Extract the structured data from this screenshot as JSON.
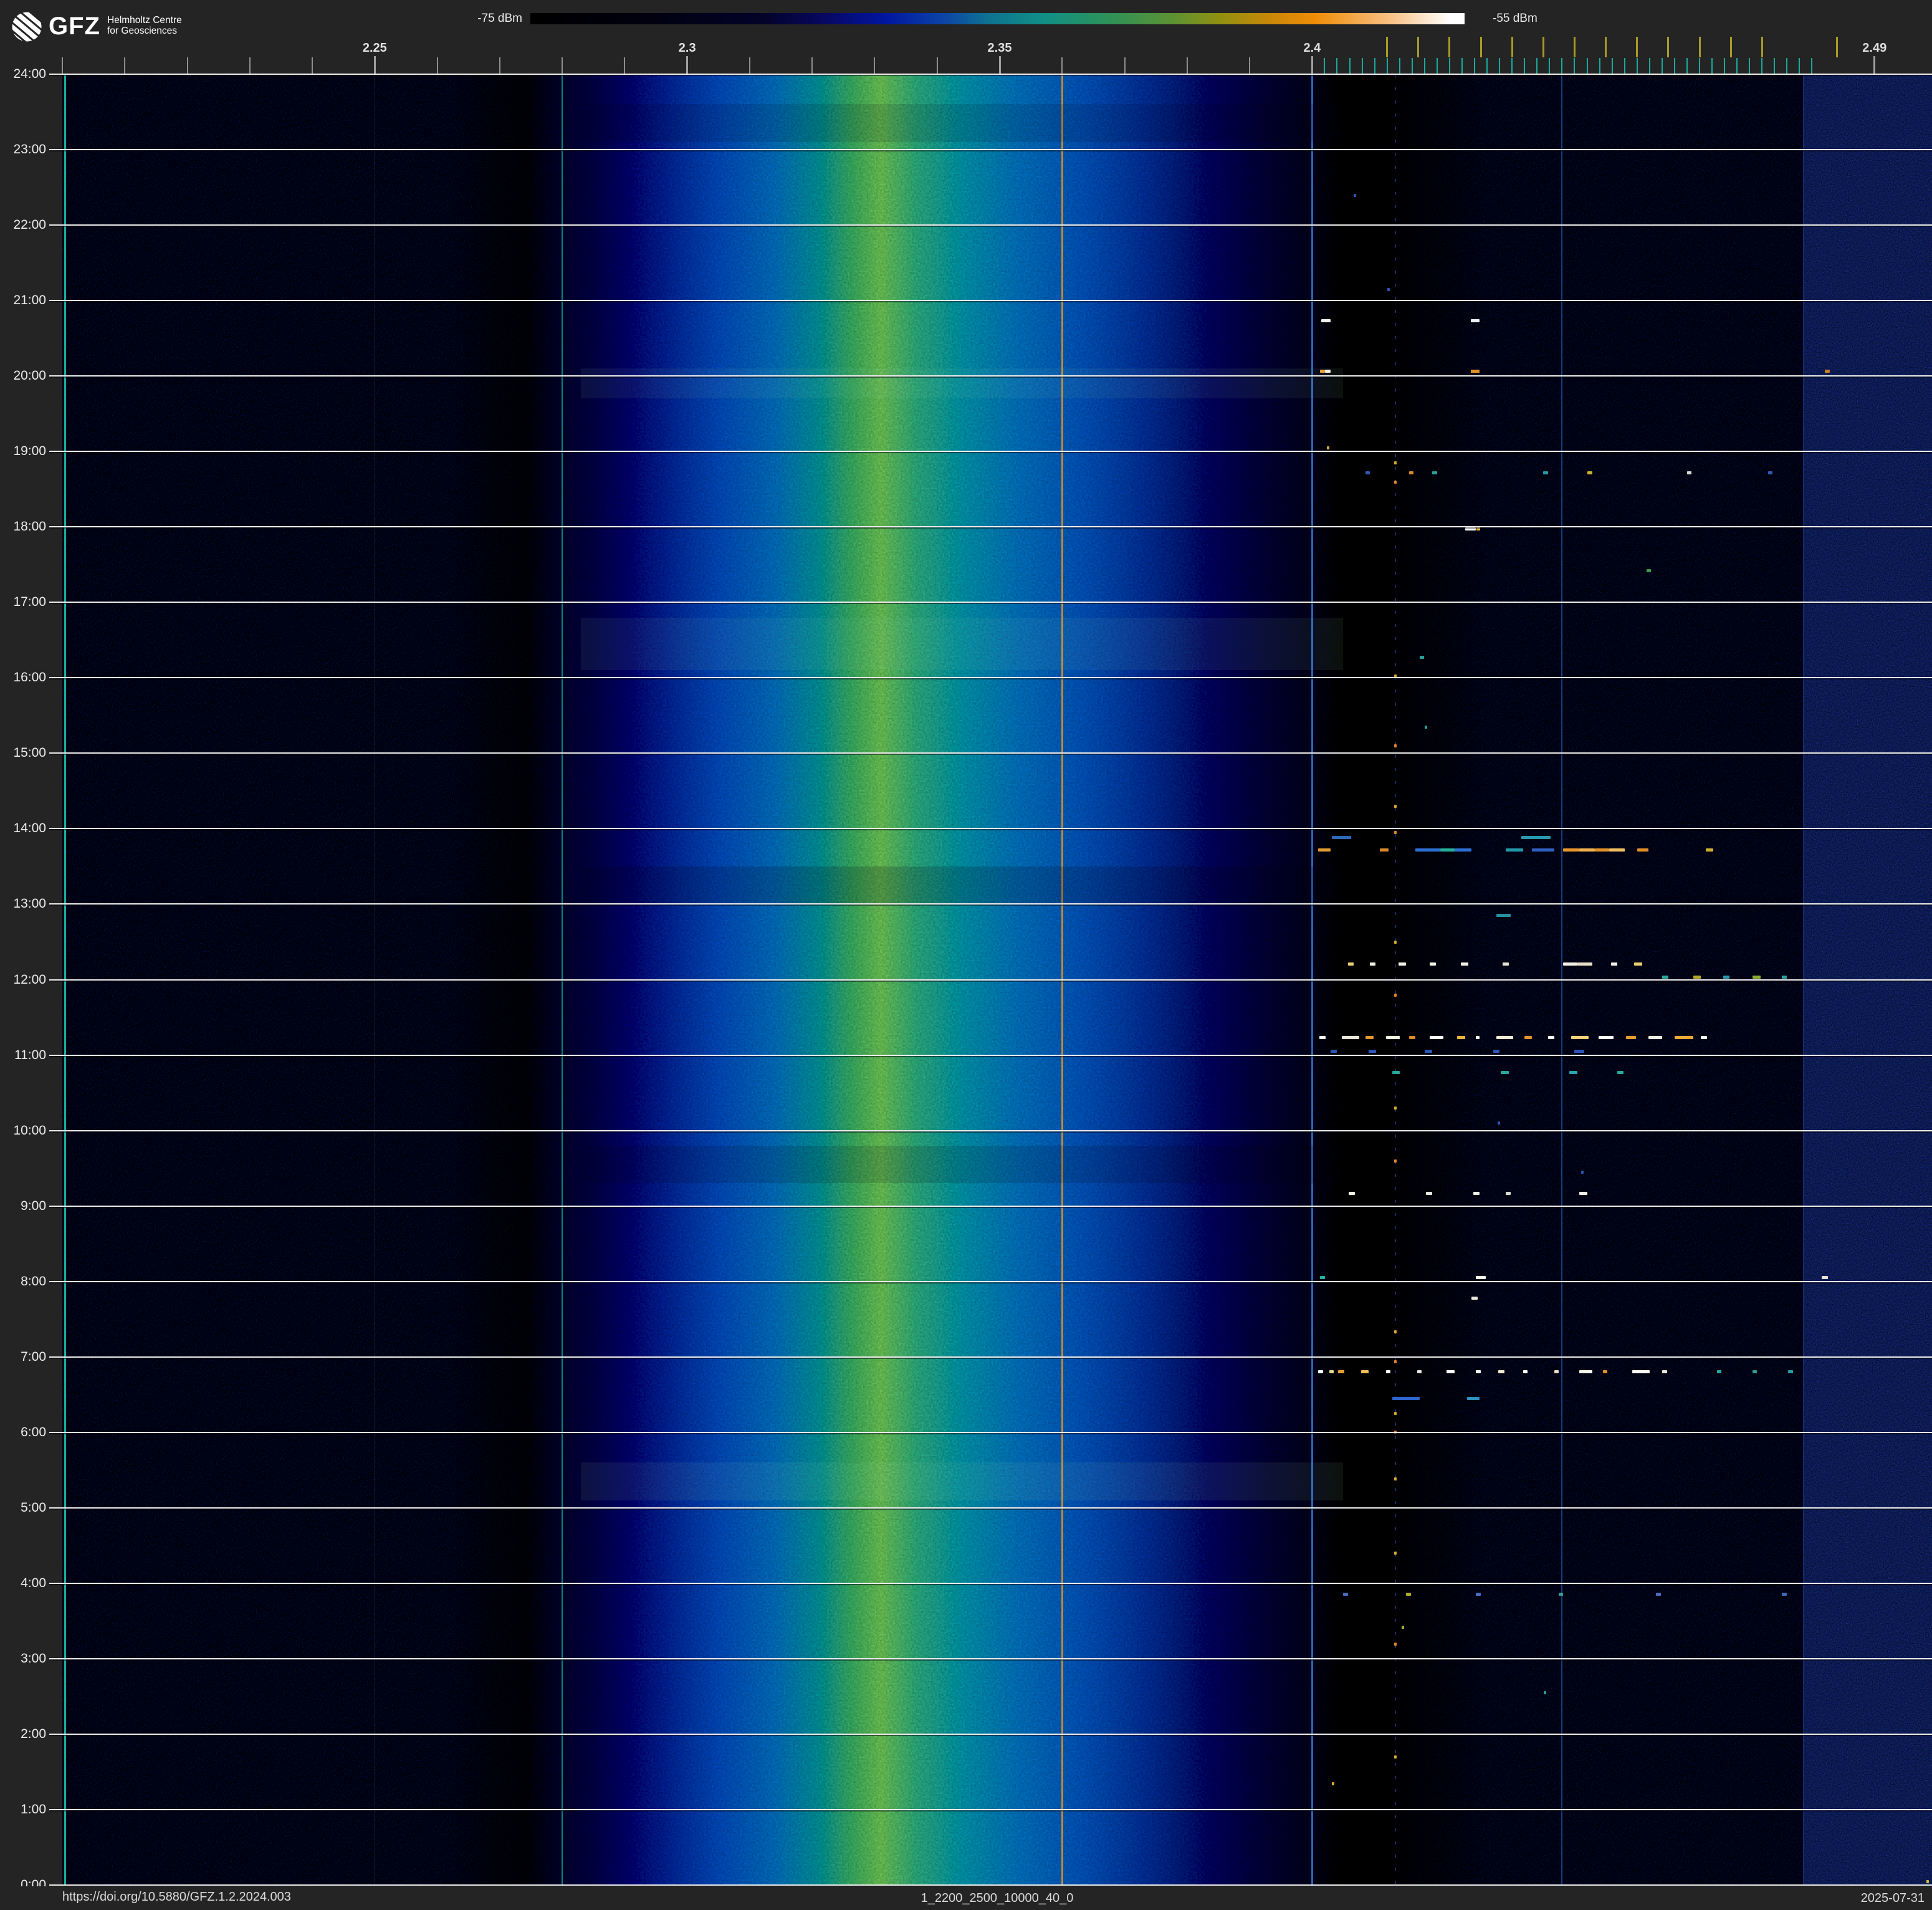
{
  "header": {
    "logo": {
      "brand": "GFZ",
      "line1": "Helmholtz Centre",
      "line2": "for Geosciences"
    },
    "colorbar": {
      "min_label": "-75 dBm",
      "max_label": "-55 dBm",
      "gradient": [
        [
          "#000000",
          0
        ],
        [
          "#010110",
          13
        ],
        [
          "#03032a",
          25
        ],
        [
          "#080866",
          32
        ],
        [
          "#0016a0",
          38
        ],
        [
          "#0c42a6",
          44
        ],
        [
          "#0e7292",
          49
        ],
        [
          "#119086",
          55
        ],
        [
          "#2e9158",
          62
        ],
        [
          "#5e9232",
          69
        ],
        [
          "#93900f",
          74
        ],
        [
          "#c78708",
          79
        ],
        [
          "#ef8d07",
          84
        ],
        [
          "#f9c083",
          92
        ],
        [
          "#ffffff",
          98.5
        ]
      ]
    }
  },
  "footer": {
    "doi": "https://doi.org/10.5880/GFZ.1.2.2024.003",
    "filename": "1_2200_2500_10000_40_0",
    "date": "2025-07-31"
  },
  "chart_data": {
    "type": "heatmap",
    "description": "24h RF waterfall spectrogram, frequency 2.2-2.5 GHz vs time of day, power -75 to -55 dBm",
    "power_scale": {
      "min_dbm": -75,
      "max_dbm": -55
    },
    "x_axis": {
      "unit": "GHz",
      "min": 2.2,
      "max": 2.4992,
      "major_ticks": [
        {
          "v": 2.25,
          "label": "2.25"
        },
        {
          "v": 2.3,
          "label": "2.3"
        },
        {
          "v": 2.35,
          "label": "2.35"
        },
        {
          "v": 2.4,
          "label": "2.4"
        },
        {
          "v": 2.49,
          "label": "2.49"
        }
      ],
      "minor_ticks": {
        "from": 2.2,
        "to": 2.4,
        "step": 0.01
      },
      "ble_channel_ticks": {
        "from": 2.402,
        "to": 2.48,
        "step": 0.002,
        "color": "#1aab9b"
      },
      "wifi_channel_ticks": {
        "freqs": [
          2.412,
          2.417,
          2.422,
          2.427,
          2.432,
          2.437,
          2.442,
          2.447,
          2.452,
          2.457,
          2.462,
          2.467,
          2.472,
          2.484
        ],
        "color": "#a89b25"
      }
    },
    "y_axis": {
      "unit": "time of day",
      "labels": [
        "24:00",
        "23:00",
        "22:00",
        "21:00",
        "20:00",
        "19:00",
        "18:00",
        "17:00",
        "16:00",
        "15:00",
        "14:00",
        "13:00",
        "12:00",
        "11:00",
        "10:00",
        "9:00",
        "8:00",
        "7:00",
        "6:00",
        "5:00",
        "4:00",
        "3:00",
        "2:00",
        "1:00",
        "0:00"
      ]
    },
    "band_profile": [
      [
        2.262,
        "#000010",
        0
      ],
      [
        2.285,
        "#041144",
        0.9
      ],
      [
        2.296,
        "#07277a",
        1
      ],
      [
        2.305,
        "#0c429c",
        1
      ],
      [
        2.314,
        "#115e9e",
        1
      ],
      [
        2.321,
        "#187a80",
        1
      ],
      [
        2.3265,
        "#379153",
        1
      ],
      [
        2.331,
        "#5ca24a",
        1
      ],
      [
        2.3365,
        "#2f9068",
        1
      ],
      [
        2.344,
        "#197d8e",
        1
      ],
      [
        2.353,
        "#13619f",
        1
      ],
      [
        2.363,
        "#0e4a9c",
        1
      ],
      [
        2.373,
        "#0a3181",
        1
      ],
      [
        2.383,
        "#071d55",
        1
      ],
      [
        2.393,
        "#040f33",
        1
      ],
      [
        2.405,
        "#02081e",
        0.85
      ],
      [
        2.428,
        "#000010",
        0
      ]
    ],
    "right_noise_zone": {
      "from": 2.4787,
      "to": 2.4992,
      "base": "#071540",
      "speckle": "#3558ec"
    },
    "vertical_lines": [
      {
        "f": 2.2004,
        "color": "#18b7a6",
        "w": 3,
        "o": 0.95
      },
      {
        "f": 2.25,
        "color": "#bbbbbb",
        "w": 1,
        "o": 0.16
      },
      {
        "f": 2.28,
        "color": "#109a8b",
        "w": 2,
        "o": 0.85
      },
      {
        "f": 2.36,
        "color": "#d08a28",
        "w": 3,
        "o": 0.95
      },
      {
        "f": 2.4,
        "color": "#2f6fd2",
        "w": 3,
        "o": 0.9
      },
      {
        "f": 2.4133,
        "color": "#2a52b4",
        "w": 2,
        "o": 0.55,
        "dash": true
      },
      {
        "f": 2.44,
        "color": "#2456bc",
        "w": 2,
        "o": 0.7
      },
      {
        "f": 2.4787,
        "color": "#1f41a6",
        "w": 2,
        "o": 0.6
      }
    ],
    "band_rows": [
      {
        "h0": 23.6,
        "h1": 23.1,
        "c": "rgba(0,0,16,0.12)"
      },
      {
        "h0": 20.1,
        "h1": 19.7,
        "c": "rgba(150,230,190,0.07)"
      },
      {
        "h0": 16.8,
        "h1": 16.1,
        "c": "rgba(150,230,190,0.07)"
      },
      {
        "h0": 13.5,
        "h1": 13.0,
        "c": "rgba(0,0,16,0.18)"
      },
      {
        "h0": 9.8,
        "h1": 9.3,
        "c": "rgba(0,0,16,0.14)"
      },
      {
        "h0": 5.6,
        "h1": 5.1,
        "c": "rgba(160,235,180,0.08)"
      }
    ],
    "events": [
      {
        "h": 20.73,
        "segs": [
          [
            2.4015,
            2.403,
            "#f2f2ec"
          ],
          [
            2.4254,
            2.4268,
            "#eef0f2"
          ]
        ]
      },
      {
        "h": 20.06,
        "segs": [
          [
            2.4013,
            2.4021,
            "#e8a23a"
          ],
          [
            2.4021,
            2.403,
            "#f5f0e0"
          ],
          [
            2.4254,
            2.4268,
            "#e2902a"
          ],
          [
            2.482,
            2.4828,
            "#c98122"
          ]
        ]
      },
      {
        "h": 18.72,
        "segs": [
          [
            2.4085,
            2.4092,
            "#2e5ab4"
          ],
          [
            2.4155,
            2.4162,
            "#d8872a"
          ],
          [
            2.4192,
            2.42,
            "#28a098"
          ],
          [
            2.437,
            2.4378,
            "#2898a8"
          ],
          [
            2.444,
            2.4448,
            "#c8b42e"
          ],
          [
            2.46,
            2.4607,
            "#d8d8cc"
          ],
          [
            2.473,
            2.4737,
            "#2e5ab4"
          ]
        ]
      },
      {
        "h": 17.97,
        "segs": [
          [
            2.4245,
            2.4262,
            "#ffffff"
          ],
          [
            2.4263,
            2.4269,
            "#e8c040"
          ]
        ]
      },
      {
        "h": 17.42,
        "segs": [
          [
            2.4535,
            2.4542,
            "#3a9a50"
          ]
        ]
      },
      {
        "h": 16.27,
        "segs": [
          [
            2.4172,
            2.4179,
            "#28a098"
          ]
        ]
      },
      {
        "h": 13.88,
        "segs": [
          [
            2.4032,
            2.4062,
            "#2d68b8"
          ],
          [
            2.4335,
            2.4382,
            "#2698b0"
          ]
        ]
      },
      {
        "h": 13.72,
        "segs": [
          [
            2.401,
            2.403,
            "#e09a30"
          ],
          [
            2.4108,
            2.4122,
            "#d9882a"
          ],
          [
            2.4165,
            2.4205,
            "#2e6fd4"
          ],
          [
            2.4205,
            2.4228,
            "#23b09a"
          ],
          [
            2.4228,
            2.4255,
            "#2e6fd4"
          ],
          [
            2.431,
            2.4338,
            "#2398a8"
          ],
          [
            2.4352,
            2.4388,
            "#2f5fc0"
          ],
          [
            2.4402,
            2.4428,
            "#e8962c"
          ],
          [
            2.4428,
            2.4452,
            "#f0b050"
          ],
          [
            2.4452,
            2.4475,
            "#e2922a"
          ],
          [
            2.4475,
            2.45,
            "#f0c060"
          ],
          [
            2.452,
            2.4538,
            "#df8f28"
          ],
          [
            2.463,
            2.4642,
            "#cfae30"
          ]
        ]
      },
      {
        "h": 12.85,
        "segs": [
          [
            2.4295,
            2.4318,
            "#2590a0"
          ]
        ]
      },
      {
        "h": 12.21,
        "segs": [
          [
            2.4057,
            2.4066,
            "#e8d070"
          ],
          [
            2.4092,
            2.4101,
            "#f5f2e8"
          ],
          [
            2.4138,
            2.415,
            "#f5f2e8"
          ],
          [
            2.4188,
            2.4198,
            "#f5f2e8"
          ],
          [
            2.4238,
            2.425,
            "#f5f2e8"
          ],
          [
            2.4305,
            2.4315,
            "#e8e4d0"
          ],
          [
            2.4402,
            2.4425,
            "#f5f2e8"
          ],
          [
            2.4425,
            2.4448,
            "#e8e0c8"
          ],
          [
            2.4478,
            2.4488,
            "#f5f2e8"
          ],
          [
            2.4515,
            2.4528,
            "#e8d070"
          ]
        ]
      },
      {
        "h": 12.03,
        "segs": [
          [
            2.456,
            2.457,
            "#2aa898"
          ],
          [
            2.461,
            2.4622,
            "#b5a92a"
          ],
          [
            2.4658,
            2.4668,
            "#2a9ab0"
          ],
          [
            2.4705,
            2.4718,
            "#8fae2f"
          ],
          [
            2.4752,
            2.476,
            "#2aa0a0"
          ]
        ]
      },
      {
        "h": 11.23,
        "segs": [
          [
            2.4012,
            2.4022,
            "#ffffff"
          ],
          [
            2.4048,
            2.4075,
            "#e8e4d8"
          ],
          [
            2.4085,
            2.4098,
            "#e2952e"
          ],
          [
            2.4118,
            2.414,
            "#f4f0e0"
          ],
          [
            2.4155,
            2.4165,
            "#d88a26"
          ],
          [
            2.4188,
            2.421,
            "#ffffff"
          ],
          [
            2.4232,
            2.4245,
            "#e8b23c"
          ],
          [
            2.4262,
            2.4268,
            "#ffffff"
          ],
          [
            2.4295,
            2.4322,
            "#f2ead6"
          ],
          [
            2.434,
            2.4352,
            "#e09230"
          ],
          [
            2.4378,
            2.4388,
            "#ffffff"
          ],
          [
            2.4415,
            2.4442,
            "#f5d27a"
          ],
          [
            2.4458,
            2.4482,
            "#ffffff"
          ],
          [
            2.4502,
            2.4518,
            "#e89a32"
          ],
          [
            2.4538,
            2.456,
            "#f2eee2"
          ],
          [
            2.458,
            2.461,
            "#e8a83a"
          ],
          [
            2.4622,
            2.4632,
            "#ffffff"
          ]
        ]
      },
      {
        "h": 11.05,
        "segs": [
          [
            2.403,
            2.404,
            "#2d55b8"
          ],
          [
            2.409,
            2.4102,
            "#2d55b8"
          ],
          [
            2.418,
            2.4192,
            "#2d55b8"
          ],
          [
            2.429,
            2.43,
            "#2d55b8"
          ],
          [
            2.442,
            2.4435,
            "#2d55b8"
          ]
        ]
      },
      {
        "h": 10.77,
        "segs": [
          [
            2.4128,
            2.414,
            "#28a89a"
          ],
          [
            2.4302,
            2.4315,
            "#28a89a"
          ],
          [
            2.4412,
            2.4425,
            "#2aa0b0"
          ],
          [
            2.4488,
            2.4498,
            "#28a89a"
          ]
        ]
      },
      {
        "h": 9.17,
        "segs": [
          [
            2.4058,
            2.4068,
            "#efefe5"
          ],
          [
            2.4182,
            2.4192,
            "#e5e5dc"
          ],
          [
            2.4258,
            2.4268,
            "#efefe5"
          ],
          [
            2.431,
            2.4318,
            "#d8d8cc"
          ],
          [
            2.4428,
            2.444,
            "#efefe5"
          ]
        ]
      },
      {
        "h": 8.05,
        "segs": [
          [
            2.4013,
            2.4021,
            "#25b0a0"
          ],
          [
            2.4262,
            2.4278,
            "#f5f5ee"
          ],
          [
            2.4815,
            2.4825,
            "#e8e2d2"
          ]
        ]
      },
      {
        "h": 7.78,
        "segs": [
          [
            2.4255,
            2.4265,
            "#e8e8e0"
          ]
        ]
      },
      {
        "h": 6.8,
        "segs": [
          [
            2.401,
            2.4018,
            "#ffffff"
          ],
          [
            2.4028,
            2.4035,
            "#e2d88a"
          ],
          [
            2.4042,
            2.4052,
            "#e8a030"
          ],
          [
            2.4078,
            2.409,
            "#f0c050"
          ],
          [
            2.4118,
            2.4125,
            "#ffffff"
          ],
          [
            2.4168,
            2.4175,
            "#e8e8e0"
          ],
          [
            2.4215,
            2.4228,
            "#ffffff"
          ],
          [
            2.4262,
            2.427,
            "#f8f8f0"
          ],
          [
            2.4298,
            2.4308,
            "#f0e8d0"
          ],
          [
            2.4338,
            2.4345,
            "#ffffff"
          ],
          [
            2.4388,
            2.4395,
            "#e8e0c8"
          ],
          [
            2.4428,
            2.4448,
            "#f5f5ea"
          ],
          [
            2.4465,
            2.4472,
            "#e09228"
          ],
          [
            2.4512,
            2.454,
            "#f8f8f2"
          ],
          [
            2.456,
            2.4568,
            "#e8e8da"
          ],
          [
            2.4648,
            2.4655,
            "#2aa8a0"
          ],
          [
            2.4705,
            2.4712,
            "#28a090"
          ],
          [
            2.4762,
            2.477,
            "#2a9aa8"
          ]
        ]
      },
      {
        "h": 6.45,
        "segs": [
          [
            2.4128,
            2.4172,
            "#2e64cc"
          ],
          [
            2.4248,
            2.4268,
            "#2e8fc0"
          ]
        ]
      },
      {
        "h": 3.85,
        "segs": [
          [
            2.405,
            2.4058,
            "#4a6ac0"
          ],
          [
            2.415,
            2.4158,
            "#b0a830"
          ],
          [
            2.4262,
            2.427,
            "#4a6ac0"
          ],
          [
            2.4395,
            2.4402,
            "#3a9a90"
          ],
          [
            2.455,
            2.4558,
            "#4a6ac0"
          ],
          [
            2.4752,
            2.476,
            "#3a6ab8"
          ]
        ]
      }
    ],
    "dots": [
      {
        "h": 18.85,
        "f": 2.4133,
        "c": "#d8a830"
      },
      {
        "h": 18.6,
        "f": 2.4133,
        "c": "#e0862a"
      },
      {
        "h": 16.03,
        "f": 2.4133,
        "c": "#d8a830"
      },
      {
        "h": 15.1,
        "f": 2.4133,
        "c": "#e0862a"
      },
      {
        "h": 14.3,
        "f": 2.4133,
        "c": "#d8a830"
      },
      {
        "h": 13.95,
        "f": 2.4133,
        "c": "#e0862a"
      },
      {
        "h": 12.5,
        "f": 2.4133,
        "c": "#d8a830"
      },
      {
        "h": 11.8,
        "f": 2.4133,
        "c": "#e0862a"
      },
      {
        "h": 10.3,
        "f": 2.4133,
        "c": "#d8a830"
      },
      {
        "h": 9.6,
        "f": 2.4133,
        "c": "#e0862a"
      },
      {
        "h": 7.34,
        "f": 2.4133,
        "c": "#d8a830"
      },
      {
        "h": 6.94,
        "f": 2.4133,
        "c": "#e0862a"
      },
      {
        "h": 6.25,
        "f": 2.4133,
        "c": "#d8a830"
      },
      {
        "h": 6.01,
        "f": 2.4133,
        "c": "#e0862a"
      },
      {
        "h": 5.39,
        "f": 2.4133,
        "c": "#d8a830"
      },
      {
        "h": 4.4,
        "f": 2.4133,
        "c": "#d8a830"
      },
      {
        "h": 3.2,
        "f": 2.4133,
        "c": "#e0862a"
      },
      {
        "h": 1.7,
        "f": 2.4133,
        "c": "#d8a830"
      },
      {
        "h": 22.4,
        "f": 2.4068,
        "c": "#2d55b8"
      },
      {
        "h": 21.15,
        "f": 2.4122,
        "c": "#2d55b8"
      },
      {
        "h": 19.05,
        "f": 2.4026,
        "c": "#d8b030"
      },
      {
        "h": 15.35,
        "f": 2.4182,
        "c": "#28a098"
      },
      {
        "h": 10.1,
        "f": 2.4299,
        "c": "#2d55b8"
      },
      {
        "h": 9.45,
        "f": 2.4432,
        "c": "#2d55b8"
      },
      {
        "h": 3.42,
        "f": 2.4145,
        "c": "#b0a830"
      },
      {
        "h": 2.55,
        "f": 2.4373,
        "c": "#28a098"
      },
      {
        "h": 1.35,
        "f": 2.4034,
        "c": "#d8b030"
      },
      {
        "h": 0.05,
        "f": 2.4985,
        "c": "#d8c030"
      }
    ]
  }
}
